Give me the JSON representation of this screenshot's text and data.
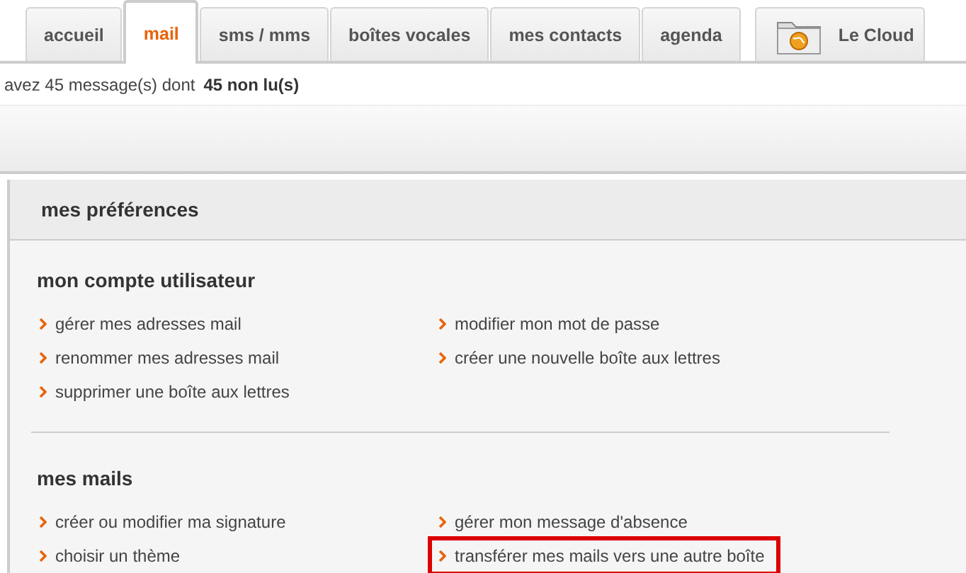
{
  "tabs": [
    {
      "label": "accueil",
      "selected": false,
      "kind": "text"
    },
    {
      "label": "mail",
      "selected": true,
      "kind": "text"
    },
    {
      "label": "sms / mms",
      "selected": false,
      "kind": "text"
    },
    {
      "label": "boîtes vocales",
      "selected": false,
      "kind": "text"
    },
    {
      "label": "mes contacts",
      "selected": false,
      "kind": "text"
    },
    {
      "label": "agenda",
      "selected": false,
      "kind": "text"
    },
    {
      "label": "Le Cloud",
      "selected": false,
      "kind": "cloud"
    }
  ],
  "message_summary": {
    "text": "avez 45 message(s) dont",
    "unread": "45 non lu(s)"
  },
  "panel": {
    "title": "mes préférences",
    "sections": [
      {
        "title": "mon compte utilisateur",
        "links": [
          {
            "label": "gérer mes adresses mail",
            "highlighted": false
          },
          {
            "label": "modifier mon mot de passe",
            "highlighted": false
          },
          {
            "label": "renommer mes adresses mail",
            "highlighted": false
          },
          {
            "label": "créer une nouvelle boîte aux lettres",
            "highlighted": false
          },
          {
            "label": "supprimer une boîte aux lettres",
            "highlighted": false
          }
        ]
      },
      {
        "title": "mes mails",
        "links": [
          {
            "label": "créer ou modifier ma signature",
            "highlighted": false
          },
          {
            "label": "gérer mon message d'absence",
            "highlighted": false
          },
          {
            "label": "choisir un thème",
            "highlighted": false
          },
          {
            "label": "transférer mes mails vers une autre boîte",
            "highlighted": true
          }
        ]
      }
    ]
  }
}
